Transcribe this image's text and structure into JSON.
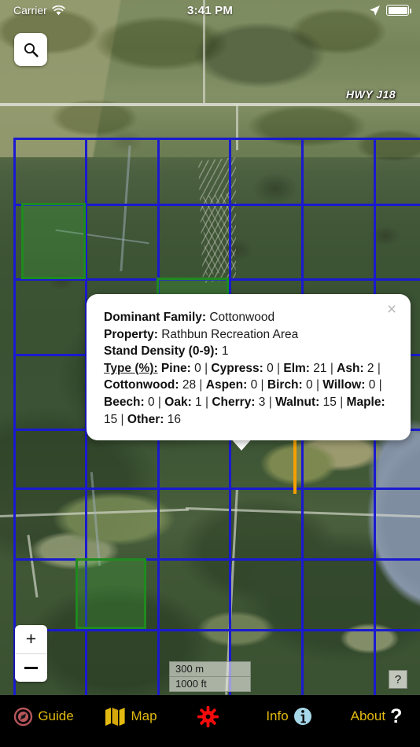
{
  "status_bar": {
    "carrier": "Carrier",
    "wifi_icon": "wifi-icon",
    "time": "3:41 PM",
    "location_icon": "location-arrow-icon",
    "battery_icon": "battery-icon"
  },
  "map": {
    "search_icon": "search-icon",
    "highway_label": "HWY J18",
    "zoom_in_label": "+",
    "zoom_out_label": "−",
    "scale_metric": "300 m",
    "scale_imperial": "1000 ft",
    "help_label": "?",
    "grid_color": "#1a1ad0",
    "selected_cell_color": "#1f8a1f",
    "highlight_line_color": "#f5a000"
  },
  "popup": {
    "close_icon": "×",
    "rows": [
      {
        "label": "Dominant Family:",
        "value": "Cottonwood"
      },
      {
        "label": "Property:",
        "value": "Rathbun Recreation Area"
      },
      {
        "label": "Stand Density (0-9):",
        "value": "1"
      }
    ],
    "type_label": "Type (%):",
    "species": [
      {
        "name": "Pine:",
        "value": "0"
      },
      {
        "name": "Cypress:",
        "value": "0"
      },
      {
        "name": "Elm:",
        "value": "21"
      },
      {
        "name": "Ash:",
        "value": "2"
      },
      {
        "name": "Cottonwood:",
        "value": "28"
      },
      {
        "name": "Aspen:",
        "value": "0"
      },
      {
        "name": "Birch:",
        "value": "0"
      },
      {
        "name": "Willow:",
        "value": "0"
      },
      {
        "name": "Beech:",
        "value": "0"
      },
      {
        "name": "Oak:",
        "value": "1"
      },
      {
        "name": "Cherry:",
        "value": "3"
      },
      {
        "name": "Walnut:",
        "value": "15"
      },
      {
        "name": "Maple:",
        "value": "15"
      },
      {
        "name": "Other:",
        "value": "16"
      }
    ],
    "separator": "|"
  },
  "tabbar": {
    "items": [
      {
        "label": "Guide",
        "icon": "guide-compass-icon",
        "color": "#b5555a"
      },
      {
        "label": "Map",
        "icon": "map-folded-icon",
        "color": "#e3ba10"
      },
      {
        "label": "",
        "icon": "gear-icon",
        "color": "#f20b0b"
      },
      {
        "label": "Info",
        "icon": "info-circle-icon",
        "color": "#a6d8ea"
      },
      {
        "label": "About",
        "icon": "question-mark-icon",
        "color": "#ffffff"
      }
    ]
  }
}
